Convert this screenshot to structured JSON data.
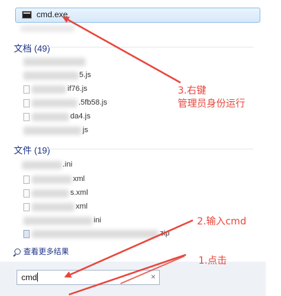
{
  "top_result": {
    "label": "cmd.exe",
    "icon": "cmd-console-icon"
  },
  "documents": {
    "header": "文档 (49)",
    "items": [
      {
        "suffix": ""
      },
      {
        "suffix": "5.js"
      },
      {
        "suffix": "if76.js"
      },
      {
        "suffix": ".5fb58.js"
      },
      {
        "suffix": "da4.js"
      },
      {
        "suffix": "js"
      }
    ]
  },
  "files": {
    "header": "文件 (19)",
    "items": [
      {
        "suffix": ".ini"
      },
      {
        "suffix": "xml"
      },
      {
        "suffix": "s.xml"
      },
      {
        "suffix": "xml"
      },
      {
        "suffix": "ini"
      },
      {
        "suffix": "zip"
      }
    ]
  },
  "more_results": "查看更多结果",
  "search": {
    "value": "cmd",
    "clear_icon": "×"
  },
  "annotations": {
    "step3_line1": "3.右键",
    "step3_line2": "管理员身份运行",
    "step2": "2.输入cmd",
    "step1": "1.点击"
  },
  "colors": {
    "annotation": "#e8463c",
    "header": "#1e3287",
    "highlight": "#d6e9fa"
  }
}
